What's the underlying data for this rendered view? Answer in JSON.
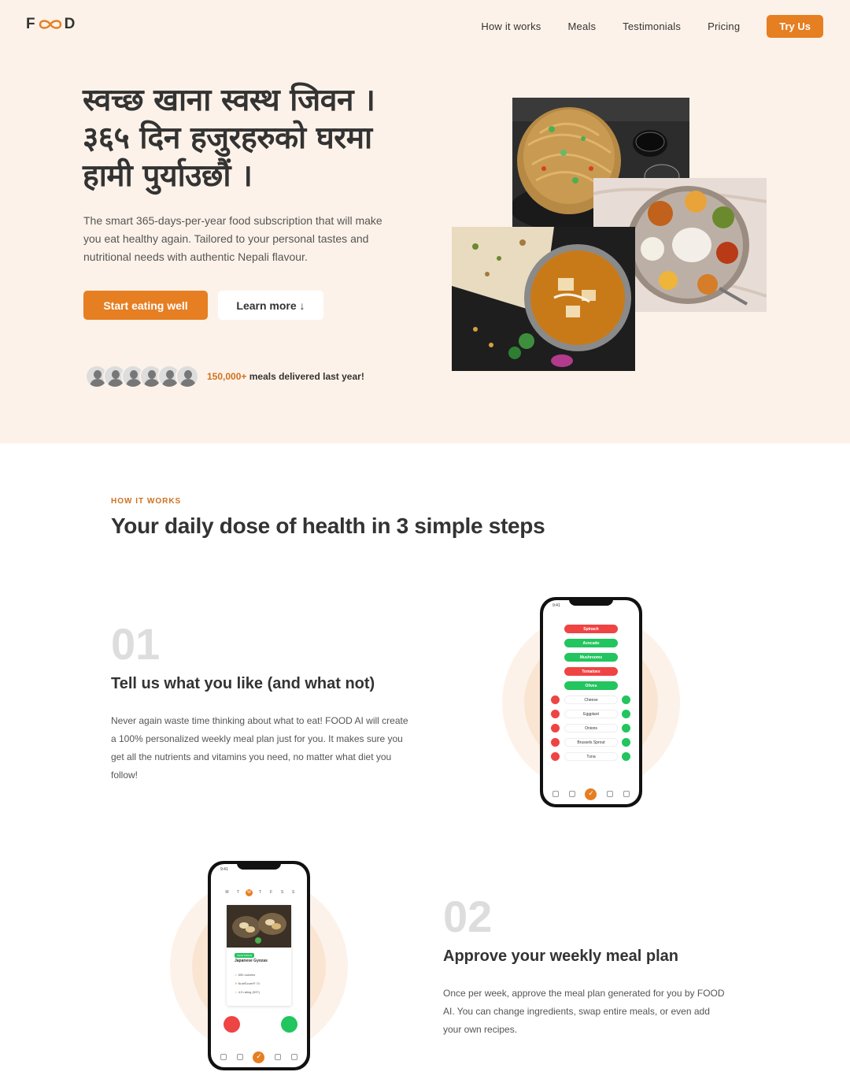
{
  "nav": {
    "logo": {
      "left": "F",
      "right": "D"
    },
    "links": [
      "How it works",
      "Meals",
      "Testimonials",
      "Pricing"
    ],
    "cta": "Try Us"
  },
  "hero": {
    "title_line1": "स्वच्छ खाना स्वस्थ जिवन ।",
    "title_line2": "३६५ दिन हजुरहरुको घरमा",
    "title_line3": "हामी पुर्याउछौं ।",
    "description": "The smart 365-days-per-year food subscription that will make you eat healthy again. Tailored to your personal tastes and nutritional needs with authentic Nepali flavour.",
    "primary_button": "Start eating well",
    "secondary_button": "Learn more ↓",
    "delivered_count": "150,000+",
    "delivered_text": "meals delivered last year!"
  },
  "how_it_works": {
    "subheading": "HOW IT WORKS",
    "title": "Your daily dose of health in 3 simple steps",
    "steps": [
      {
        "number": "01",
        "title": "Tell us what you like (and what not)",
        "description": "Never again waste time thinking about what to eat! FOOD AI will create a 100% personalized weekly meal plan just for you. It makes sure you get all the nutrients and vitamins you need, no matter what diet you follow!"
      },
      {
        "number": "02",
        "title": "Approve your weekly meal plan",
        "description": "Once per week, approve the meal plan generated for you by FOOD AI. You can change ingredients, swap entire meals, or even add your own recipes."
      }
    ]
  },
  "phone1": {
    "time": "9:41",
    "ingredients": [
      {
        "name": "Spinach",
        "state": "dislike"
      },
      {
        "name": "Avocado",
        "state": "like"
      },
      {
        "name": "Mushrooms",
        "state": "like"
      },
      {
        "name": "Tomatoes",
        "state": "dislike"
      },
      {
        "name": "Olives",
        "state": "like"
      },
      {
        "name": "Cheese",
        "state": "neutral"
      },
      {
        "name": "Eggplant",
        "state": "neutral"
      },
      {
        "name": "Onions",
        "state": "neutral"
      },
      {
        "name": "Brussels Sprout",
        "state": "neutral"
      },
      {
        "name": "Tuna",
        "state": "neutral"
      }
    ]
  },
  "phone2": {
    "time": "9:41",
    "weekdays": [
      "M",
      "T",
      "W",
      "T",
      "F",
      "S",
      "S"
    ],
    "tag": "VEGETARIAN",
    "meal": "Japanese Gyozas",
    "stat1": "650 calories",
    "stat2": "NutriScore® 74",
    "stat3": "4.9 rating (537)"
  },
  "colors": {
    "accent": "#e67e22",
    "hero_bg": "#fdf2e9",
    "like": "#22c55e",
    "dislike": "#ef4444"
  }
}
